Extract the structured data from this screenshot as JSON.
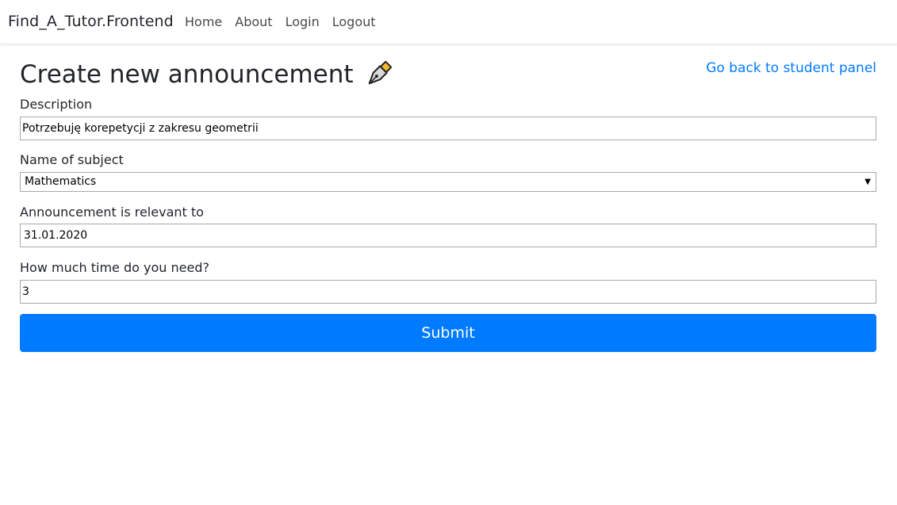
{
  "navbar": {
    "brand": "Find_A_Tutor.Frontend",
    "links": [
      "Home",
      "About",
      "Login",
      "Logout"
    ]
  },
  "page": {
    "title": "Create new announcement",
    "title_icon": "fountain-pen-icon",
    "back_link": "Go back to student panel"
  },
  "form": {
    "description": {
      "label": "Description",
      "value": "Potrzebuję korepetycji z zakresu geometrii"
    },
    "subject": {
      "label": "Name of subject",
      "selected": "Mathematics",
      "arrow": "▼"
    },
    "relevant_to": {
      "label": "Announcement is relevant to",
      "value": "31.01.2020"
    },
    "time_needed": {
      "label": "How much time do you need?",
      "value": "3"
    },
    "submit_label": "Submit"
  },
  "colors": {
    "primary": "#007bff",
    "link": "#007bff",
    "text": "#212529"
  }
}
